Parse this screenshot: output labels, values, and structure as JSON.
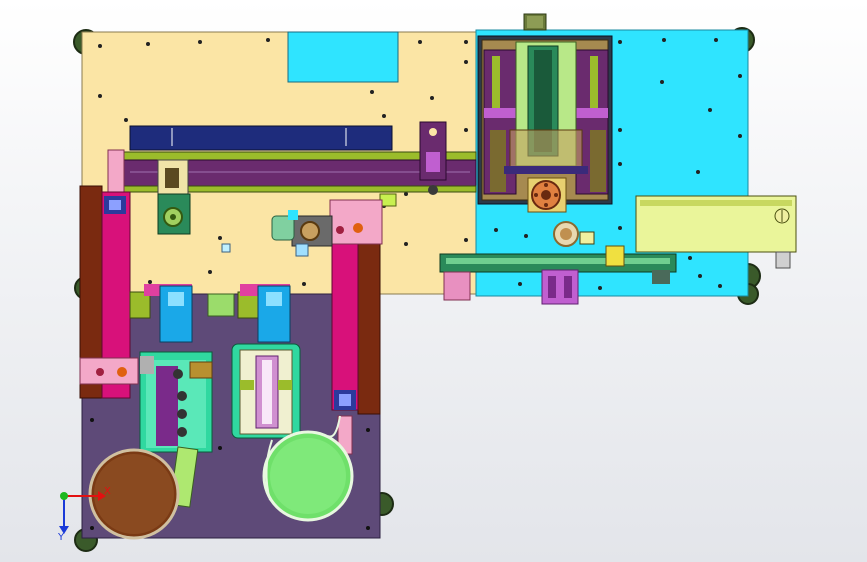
{
  "viewport": {
    "background_top": "#ffffff",
    "background_bottom": "#e3e5ea"
  },
  "colors": {
    "plate_cream": "#fbe5a5",
    "plate_cyan": "#2fe4ff",
    "plate_purple": "#5e4a78",
    "magenta": "#d8117a",
    "brown": "#7a2a10",
    "olive": "#9bbc2b",
    "dark_purple": "#6a2b6e",
    "navy": "#1e2c7c",
    "teal": "#2a8a5a",
    "sky": "#1aa8e8",
    "lilac": "#c05fd0",
    "light_green": "#6fe06a",
    "caster_green": "#3a5a2a",
    "mint": "#30d8a0",
    "gray_steel": "#8c8c8c"
  },
  "triad": {
    "x_label": "X",
    "y_label": "Y",
    "x_color": "#e31010",
    "y_color": "#1a3ad8",
    "origin_color": "#1db81d"
  }
}
